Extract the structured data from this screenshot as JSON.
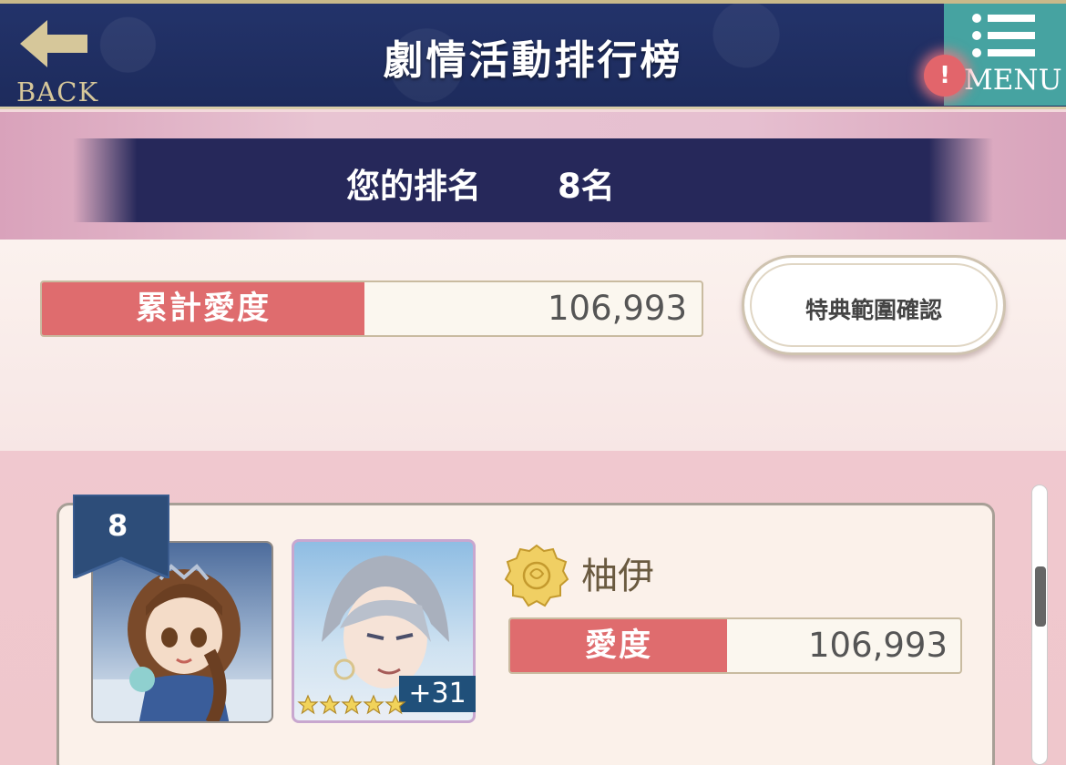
{
  "header": {
    "back_label": "BACK",
    "title": "劇情活動排行榜",
    "menu_label": "MENU",
    "menu_alert": "!"
  },
  "my_rank": {
    "label": "您的排名",
    "value": "8名"
  },
  "total_love": {
    "label": "累計愛度",
    "value": "106,993"
  },
  "bonus_button": {
    "label": "特典範圍確認"
  },
  "ranking_list": [
    {
      "rank": "8",
      "name": "柚伊",
      "love_label": "愛度",
      "love_value": "106,993",
      "card_bonus": "+31",
      "card_stars": 5,
      "medal_icon": "gold-rose-medal-icon"
    }
  ],
  "colors": {
    "header_bg": "#23336a",
    "menu_bg": "#46a3a1",
    "label_red": "#df6c6e",
    "rank_bar": "#26285a"
  }
}
